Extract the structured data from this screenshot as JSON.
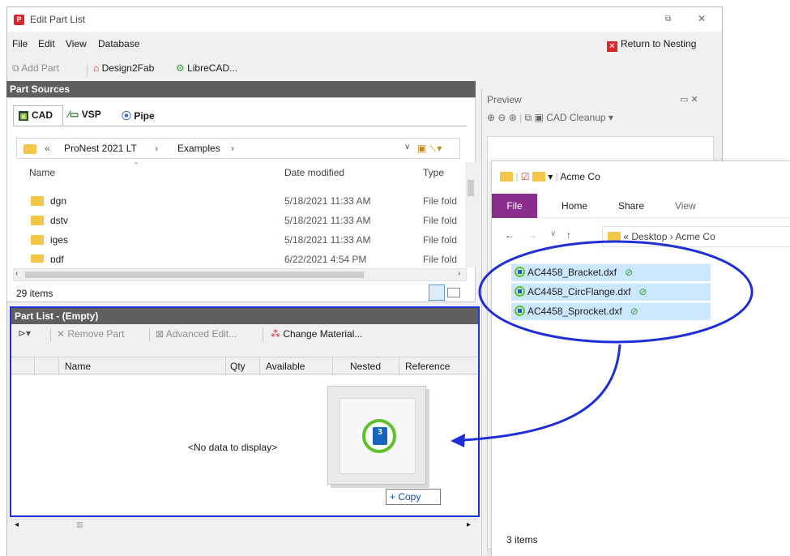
{
  "window": {
    "title": "Edit Part List",
    "restore_glyph": "⧉",
    "close_glyph": "✕",
    "icon_letter": "P"
  },
  "menu": [
    "File",
    "Edit",
    "View",
    "Database"
  ],
  "return_button": "Return to Nesting",
  "toolbar": {
    "add_part": "Add Part",
    "design2fab": "Design2Fab",
    "librecad": "LibreCAD..."
  },
  "part_sources": {
    "header": "Part Sources",
    "tabs": [
      "CAD",
      "VSP",
      "Pipe"
    ],
    "breadcrumb": [
      "«",
      "ProNest 2021 LT",
      "›",
      "Examples",
      "›"
    ],
    "columns": [
      "Name",
      "Date modified",
      "Type"
    ],
    "files": [
      {
        "name": "dgn",
        "date": "5/18/2021 11:33 AM",
        "type": "File fold"
      },
      {
        "name": "dstv",
        "date": "5/18/2021 11:33 AM",
        "type": "File fold"
      },
      {
        "name": "iges",
        "date": "5/18/2021 11:33 AM",
        "type": "File fold"
      },
      {
        "name": "pdf",
        "date": "6/22/2021 4:54 PM",
        "type": "File fold"
      }
    ],
    "status": "29 items"
  },
  "part_list": {
    "header": "Part List  -  (Empty)",
    "remove_part": "Remove Part",
    "advanced_edit": "Advanced Edit...",
    "change_material": "Change Material...",
    "columns": [
      "Name",
      "Qty",
      "Available",
      "Nested",
      "Reference"
    ],
    "empty_text": "<No data to display>",
    "copy_badge": "+ Copy",
    "drag_number": "3"
  },
  "preview": {
    "title": "Preview",
    "controls": "▭  ✕",
    "cad_cleanup": "CAD Cleanup ▾"
  },
  "explorer": {
    "title": "Acme Co",
    "ribbon_tabs": [
      "File",
      "Home",
      "Share",
      "View"
    ],
    "address": [
      "«",
      "Desktop",
      "›",
      "Acme Co"
    ],
    "files": [
      "AC4458_Bracket.dxf",
      "AC4458_CircFlange.dxf",
      "AC4458_Sprocket.dxf"
    ],
    "status": "3 items"
  },
  "colors": {
    "annotation_blue": "#1f2fd6",
    "panel_header": "#5f5f5f",
    "file_tab": "#8b2d8d",
    "dxf_green": "#5fc12a"
  }
}
